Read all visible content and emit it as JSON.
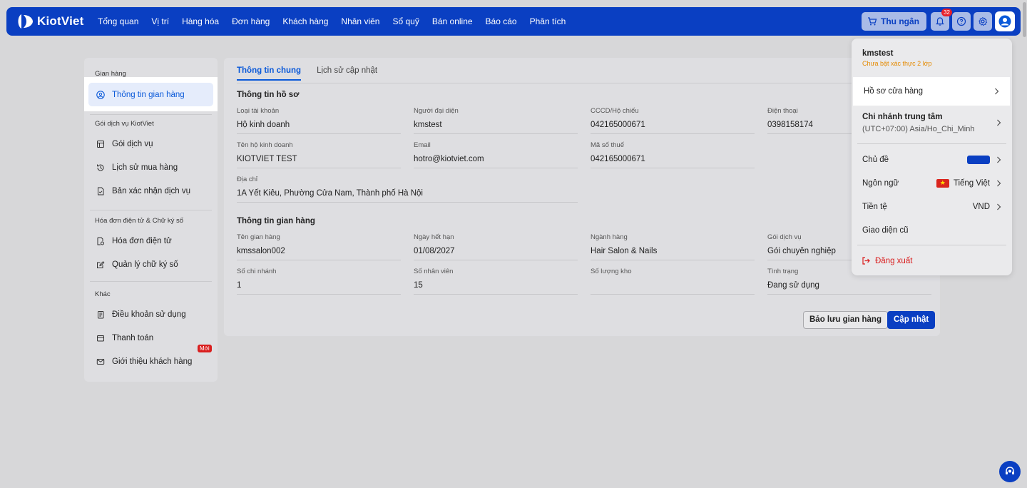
{
  "brand": {
    "name": "KiotViet"
  },
  "nav": {
    "items": [
      "Tổng quan",
      "Vị trí",
      "Hàng hóa",
      "Đơn hàng",
      "Khách hàng",
      "Nhân viên",
      "Sổ quỹ",
      "Bán online",
      "Báo cáo",
      "Phân tích"
    ],
    "cashier_label": "Thu ngân",
    "notification_count": "32"
  },
  "sidebar": {
    "group1": "Gian hàng",
    "active_item": "Thông tin gian hàng",
    "group2": "Gói dịch vụ KiotViet",
    "items2": [
      "Gói dịch vụ",
      "Lịch sử mua hàng",
      "Bản xác nhận dịch vụ"
    ],
    "group3": "Hóa đơn điện tử & Chữ ký số",
    "items3": [
      "Hóa đơn điện tử",
      "Quản lý chữ ký số"
    ],
    "group4": "Khác",
    "items4": [
      "Điều khoản sử dụng",
      "Thanh toán",
      "Giới thiệu khách hàng"
    ],
    "new_badge": "Mới"
  },
  "tabs": {
    "active": "Thông tin chung",
    "inactive": "Lịch sử cập nhật"
  },
  "profile": {
    "title": "Thông tin hồ sơ",
    "fields": [
      {
        "label": "Loại tài khoản",
        "value": "Hộ kinh doanh"
      },
      {
        "label": "Người đại diện",
        "value": "kmstest"
      },
      {
        "label": "CCCD/Hộ chiếu",
        "value": "042165000671"
      },
      {
        "label": "Điện thoại",
        "value": "0398158174"
      },
      {
        "label": "Tên hộ kinh doanh",
        "value": "KIOTVIET TEST"
      },
      {
        "label": "Email",
        "value": "hotro@kiotviet.com"
      },
      {
        "label": "Mã số thuế",
        "value": "042165000671"
      },
      {
        "label": "Địa chỉ",
        "value": "1A Yết Kiêu, Phường Cửa Nam, Thành phố Hà Nội"
      }
    ]
  },
  "store": {
    "title": "Thông tin gian hàng",
    "fields": [
      {
        "label": "Tên gian hàng",
        "value": "kmssalon002"
      },
      {
        "label": "Ngày hết hạn",
        "value": "01/08/2027"
      },
      {
        "label": "Ngành hàng",
        "value": "Hair Salon & Nails"
      },
      {
        "label": "Gói dịch vụ",
        "value": "Gói chuyên nghiệp"
      },
      {
        "label": "Số chi nhánh",
        "value": "1"
      },
      {
        "label": "Số nhân viên",
        "value": "15"
      },
      {
        "label": "Số lượng kho",
        "value": ""
      },
      {
        "label": "Tình trạng",
        "value": "Đang sử dụng"
      }
    ]
  },
  "actions": {
    "backup": "Bảo lưu gian hàng",
    "update": "Cập nhật"
  },
  "dropdown": {
    "username": "kmstest",
    "warning": "Chưa bật xác thực 2 lớp",
    "store_profile": "Hồ sơ cửa hàng",
    "branch_name": "Chi nhánh trung tâm",
    "branch_tz": "(UTC+07:00) Asia/Ho_Chi_Minh",
    "theme": "Chủ đề",
    "theme_color": "#0a3fc2",
    "language": "Ngôn ngữ",
    "language_value": "Tiếng Việt",
    "currency": "Tiền tệ",
    "currency_value": "VND",
    "old_ui": "Giao diện cũ",
    "logout": "Đăng xuất"
  }
}
